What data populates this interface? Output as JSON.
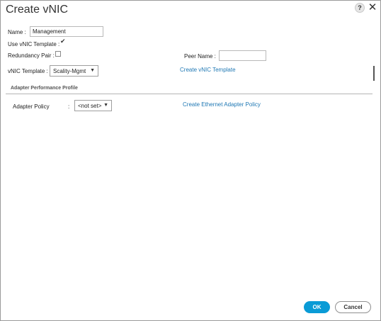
{
  "dialog": {
    "title": "Create vNIC",
    "help_icon": "?",
    "close_icon": "✕"
  },
  "form": {
    "name_label": "Name :",
    "name_value": "Management",
    "use_template_label": "Use vNIC Template :",
    "use_template_checked": true,
    "redundancy_label": "Redundancy Pair :",
    "redundancy_checked": false,
    "peer_name_label": "Peer Name :",
    "peer_name_value": "",
    "template_label": "vNIC Template :",
    "template_value": "Scality-Mgmt",
    "create_template_link": "Create vNIC Template"
  },
  "adapter_section": {
    "header": "Adapter Performance Profile",
    "policy_label": "Adapter Policy",
    "policy_colon": ":",
    "policy_value": "<not set>",
    "create_policy_link": "Create Ethernet Adapter Policy"
  },
  "footer": {
    "ok_label": "OK",
    "cancel_label": "Cancel"
  },
  "colors": {
    "accent": "#0a9bd6",
    "link": "#1f78b4"
  }
}
